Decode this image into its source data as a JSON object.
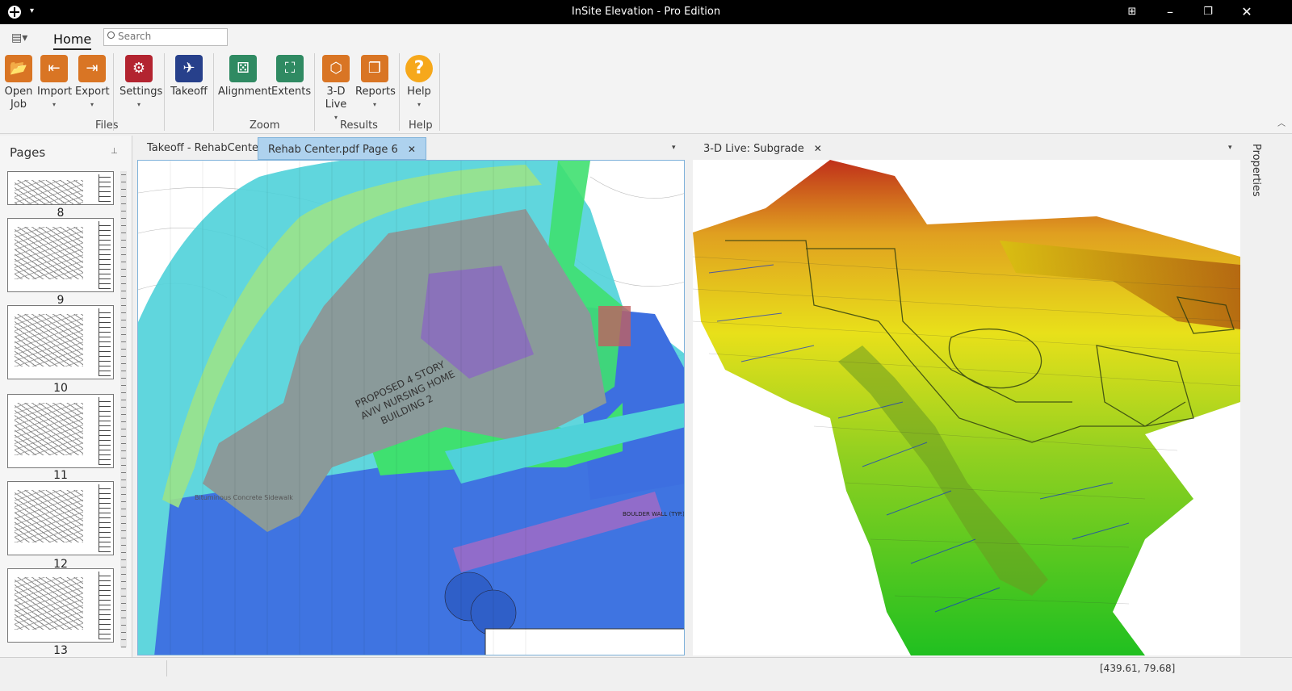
{
  "window": {
    "title": "InSite Elevation - Pro Edition"
  },
  "ribbon": {
    "tab": "Home",
    "search_placeholder": "Search",
    "buttons": {
      "open_job": "Open Job",
      "import": "Import",
      "export": "Export",
      "settings": "Settings",
      "takeoff": "Takeoff",
      "alignment": "Alignment",
      "extents": "Extents",
      "live3d": "3-D Live",
      "reports": "Reports",
      "help": "Help"
    },
    "groups": {
      "files": "Files",
      "zoom": "Zoom",
      "results": "Results",
      "help": "Help"
    }
  },
  "pages_panel": {
    "title": "Pages",
    "thumbnails": [
      "8",
      "9",
      "10",
      "11",
      "12",
      "13"
    ]
  },
  "doc_tabs": [
    {
      "label": "Takeoff - RehabCenter",
      "active": false
    },
    {
      "label": "Rehab Center.pdf Page 6",
      "active": true
    }
  ],
  "view_tab": {
    "label": "3-D Live: Subgrade"
  },
  "plan_labels": {
    "building": "PROPOSED 4 STORY",
    "building2": "AVIV NURSING HOME",
    "building3": "BUILDING 2",
    "sidewalk": "Bituminous Concrete Sidewalk",
    "wall": "BOULDER WALL (TYP.)"
  },
  "properties_label": "Properties",
  "status": {
    "coords": "[439.61, 79.68]"
  },
  "colors": {
    "cyan": "#4fd1d9",
    "blue": "#3d6fe0",
    "green": "#3fe070",
    "gray": "#8a9a9a",
    "purple": "#8a6bbf"
  }
}
